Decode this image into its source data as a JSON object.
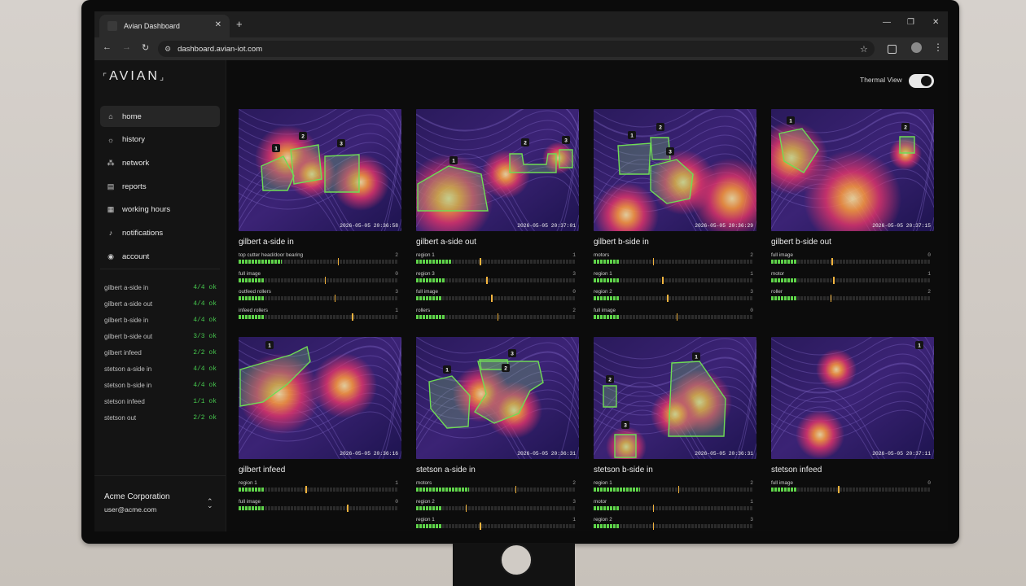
{
  "browser": {
    "tab_title": "Avian Dashboard",
    "url": "dashboard.avian-iot.com"
  },
  "app": {
    "logo": "AVIAN",
    "thermal_view_label": "Thermal View",
    "thermal_view_on": true
  },
  "nav": [
    {
      "label": "home",
      "icon": "home-icon",
      "active": true
    },
    {
      "label": "history",
      "icon": "sun-icon"
    },
    {
      "label": "network",
      "icon": "network-icon"
    },
    {
      "label": "reports",
      "icon": "chart-icon"
    },
    {
      "label": "working hours",
      "icon": "calendar-icon"
    },
    {
      "label": "notifications",
      "icon": "bell-icon"
    },
    {
      "label": "account",
      "icon": "user-icon"
    }
  ],
  "status_list": [
    {
      "name": "gilbert a-side in",
      "status": "4/4 ok"
    },
    {
      "name": "gilbert a-side out",
      "status": "4/4 ok"
    },
    {
      "name": "gilbert b-side in",
      "status": "4/4 ok"
    },
    {
      "name": "gilbert b-side out",
      "status": "3/3 ok"
    },
    {
      "name": "gilbert infeed",
      "status": "2/2 ok"
    },
    {
      "name": "stetson a-side in",
      "status": "4/4 ok"
    },
    {
      "name": "stetson b-side in",
      "status": "4/4 ok"
    },
    {
      "name": "stetson infeed",
      "status": "1/1 ok"
    },
    {
      "name": "stetson out",
      "status": "2/2 ok"
    }
  ],
  "account": {
    "org": "Acme Corporation",
    "email": "user@acme.com"
  },
  "colors": {
    "accent_green": "#5fd44a",
    "status_ok": "#46c84e",
    "threshold": "#f2b33d"
  },
  "cameras": [
    {
      "name": "gilbert a-side in",
      "timestamp": "2026-05-05 20:36:58",
      "zones": [
        "1",
        "2",
        "3"
      ],
      "regions": [
        {
          "label": "top cutter head/door bearing",
          "count": "2",
          "level": 0.27,
          "threshold": 0.62
        },
        {
          "label": "full image",
          "count": "0",
          "level": 0.16,
          "threshold": 0.54
        },
        {
          "label": "outfeed rollers",
          "count": "3",
          "level": 0.16,
          "threshold": 0.6
        },
        {
          "label": "infeed rollers",
          "count": "1",
          "level": 0.16,
          "threshold": 0.71
        }
      ]
    },
    {
      "name": "gilbert a-side out",
      "timestamp": "2026-05-05 20:37:01",
      "zones": [
        "1",
        "2",
        "3"
      ],
      "regions": [
        {
          "label": "region 1",
          "count": "1",
          "level": 0.22,
          "threshold": 0.4
        },
        {
          "label": "region 3",
          "count": "3",
          "level": 0.18,
          "threshold": 0.44
        },
        {
          "label": "full image",
          "count": "0",
          "level": 0.16,
          "threshold": 0.47
        },
        {
          "label": "rollers",
          "count": "2",
          "level": 0.18,
          "threshold": 0.51
        }
      ]
    },
    {
      "name": "gilbert b-side in",
      "timestamp": "2026-05-05 20:36:29",
      "zones": [
        "1",
        "2",
        "3"
      ],
      "regions": [
        {
          "label": "motors",
          "count": "2",
          "level": 0.16,
          "threshold": 0.37
        },
        {
          "label": "region 1",
          "count": "1",
          "level": 0.16,
          "threshold": 0.43
        },
        {
          "label": "region 2",
          "count": "3",
          "level": 0.16,
          "threshold": 0.46
        },
        {
          "label": "full image",
          "count": "0",
          "level": 0.16,
          "threshold": 0.52
        }
      ]
    },
    {
      "name": "gilbert b-side out",
      "timestamp": "2026-05-05 20:37:15",
      "zones": [
        "1",
        "2"
      ],
      "regions": [
        {
          "label": "full image",
          "count": "0",
          "level": 0.16,
          "threshold": 0.38
        },
        {
          "label": "motor",
          "count": "1",
          "level": 0.16,
          "threshold": 0.39
        },
        {
          "label": "roller",
          "count": "2",
          "level": 0.16,
          "threshold": 0.37
        }
      ]
    },
    {
      "name": "gilbert infeed",
      "timestamp": "2026-05-05 20:36:16",
      "zones": [
        "1"
      ],
      "regions": [
        {
          "label": "region 1",
          "count": "1",
          "level": 0.16,
          "threshold": 0.42
        },
        {
          "label": "full image",
          "count": "0",
          "level": 0.16,
          "threshold": 0.68
        }
      ]
    },
    {
      "name": "stetson a-side in",
      "timestamp": "2026-05-05 20:36:31",
      "zones": [
        "1",
        "2",
        "3"
      ],
      "regions": [
        {
          "label": "motors",
          "count": "2",
          "level": 0.33,
          "threshold": 0.62
        },
        {
          "label": "region 2",
          "count": "3",
          "level": 0.16,
          "threshold": 0.31
        },
        {
          "label": "region 1",
          "count": "1",
          "level": 0.16,
          "threshold": 0.4
        }
      ]
    },
    {
      "name": "stetson b-side in",
      "timestamp": "2026-05-05 20:36:31",
      "zones": [
        "1",
        "2",
        "3"
      ],
      "regions": [
        {
          "label": "region 1",
          "count": "2",
          "level": 0.29,
          "threshold": 0.53
        },
        {
          "label": "motor",
          "count": "1",
          "level": 0.16,
          "threshold": 0.37
        },
        {
          "label": "region 2",
          "count": "3",
          "level": 0.16,
          "threshold": 0.37
        }
      ]
    },
    {
      "name": "stetson infeed",
      "timestamp": "2026-05-05 20:37:11",
      "zones": [
        "1"
      ],
      "regions": [
        {
          "label": "full image",
          "count": "0",
          "level": 0.16,
          "threshold": 0.42
        }
      ]
    }
  ]
}
